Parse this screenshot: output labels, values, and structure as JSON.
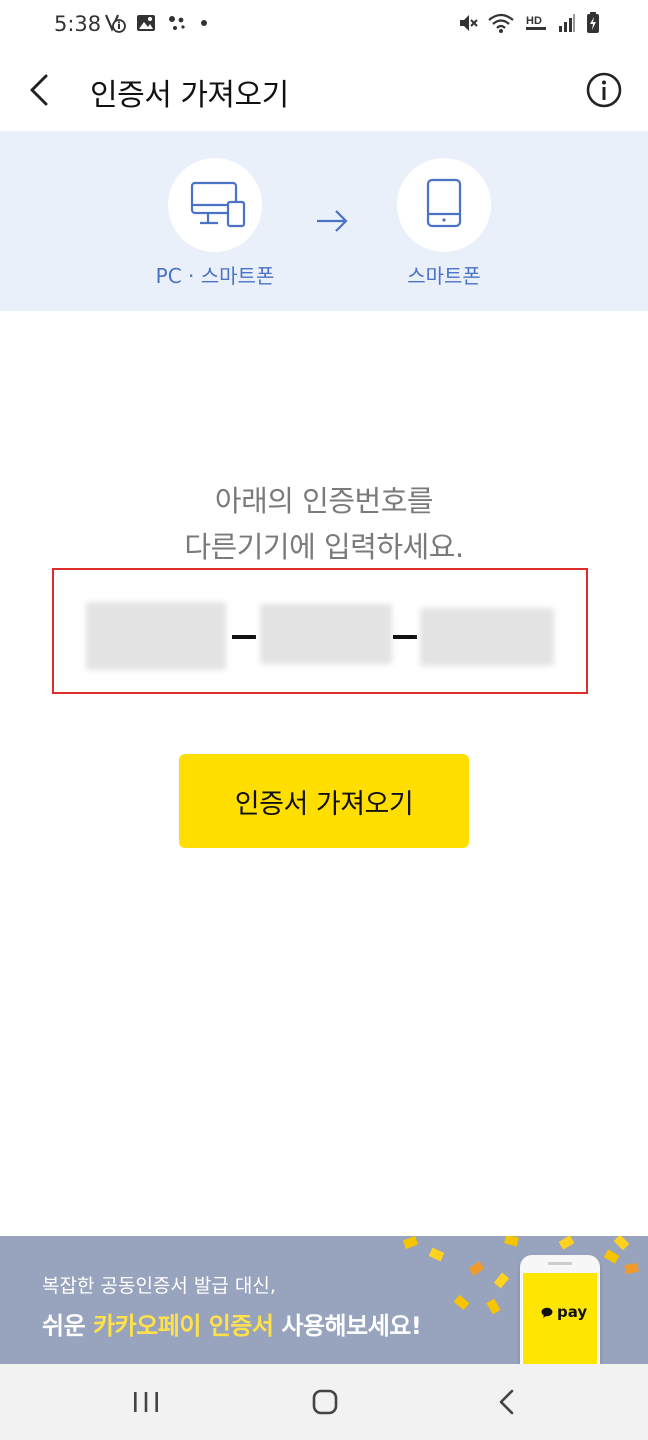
{
  "status_bar": {
    "time": "5:38",
    "left_icons": [
      "download-info-icon",
      "image-icon",
      "assistant-dots-icon",
      "dot-icon"
    ],
    "right_icons": [
      "mute-icon",
      "wifi-icon",
      "hd-voice-icon",
      "signal-icon",
      "battery-charging-icon"
    ],
    "hd_label": "HD"
  },
  "header": {
    "title": "인증서 가져오기",
    "back_icon": "chevron-left-icon",
    "info_icon": "info-icon"
  },
  "transfer": {
    "from_label": "PC · 스마트폰",
    "to_label": "스마트폰",
    "from_icon": "pc-phone-icon",
    "arrow_icon": "arrow-right-icon",
    "to_icon": "smartphone-icon"
  },
  "instruction": {
    "line1": "아래의 인증번호를",
    "line2": "다른기기에 입력하세요."
  },
  "auth_code": {
    "segments": [
      "",
      "",
      ""
    ],
    "note": "obscured"
  },
  "import_button": {
    "label": "인증서 가져오기"
  },
  "promo": {
    "line1": "복잡한 공동인증서 발급 대신,",
    "line2_prefix": "쉬운 ",
    "line2_highlight": "카카오페이 인증서",
    "line2_suffix": " 사용해보세요!",
    "pay_text": "pay"
  },
  "nav": {
    "recent_icon": "recent-apps-icon",
    "home_icon": "home-icon",
    "back_icon": "back-icon"
  },
  "colors": {
    "accent_yellow": "#ffde00",
    "banner_bg": "#eaf0fa",
    "label_blue": "#4a72c6",
    "highlight_box": "#e02b2b",
    "promo_bg": "#98a3bd",
    "promo_highlight": "#ffe14a"
  }
}
